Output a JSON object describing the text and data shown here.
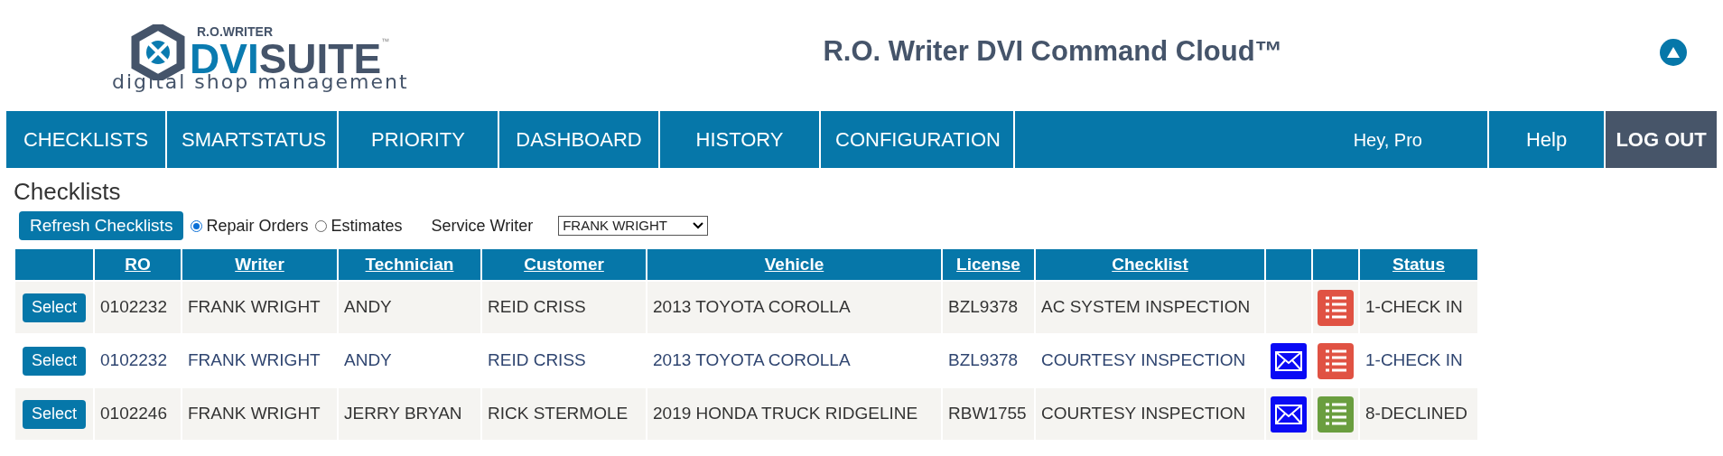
{
  "logo": {
    "brand_top": "R.O.WRITER",
    "brand_main_a": "DVI",
    "brand_main_b": "SUITE",
    "trademark": "™",
    "tagline": "digital shop management"
  },
  "title": "R.O. Writer DVI Command Cloud™",
  "nav": [
    {
      "label": "CHECKLISTS"
    },
    {
      "label": "SMARTSTATUS"
    },
    {
      "label": "PRIORITY"
    },
    {
      "label": "DASHBOARD"
    },
    {
      "label": "HISTORY"
    },
    {
      "label": "CONFIGURATION"
    }
  ],
  "greeting": "Hey, Pro",
  "help": "Help",
  "logout": "LOG OUT",
  "heading": "Checklists",
  "refresh_button": "Refresh Checklists",
  "radios": [
    {
      "label": "Repair Orders",
      "selected": true
    },
    {
      "label": "Estimates",
      "selected": false
    }
  ],
  "service_writer": {
    "label": "Service Writer",
    "value": "FRANK WRIGHT"
  },
  "table": {
    "columns": [
      "",
      "RO",
      "Writer",
      "Technician",
      "Customer",
      "Vehicle",
      "License",
      "Checklist",
      "",
      "",
      "Status"
    ],
    "rows": [
      {
        "button": "Select",
        "ro": "0102232",
        "writer": "FRANK WRIGHT",
        "technician": "ANDY",
        "customer": "REID CRISS",
        "vehicle": "2013 TOYOTA COROLLA",
        "license": "BZL9378",
        "checklist": "AC SYSTEM INSPECTION",
        "email": false,
        "color": "#e05243",
        "status": "1-CHECK IN"
      },
      {
        "button": "Select",
        "ro": "0102232",
        "writer": "FRANK WRIGHT",
        "technician": "ANDY",
        "customer": "REID CRISS",
        "vehicle": "2013 TOYOTA COROLLA",
        "license": "BZL9378",
        "checklist": "COURTESY INSPECTION",
        "email": true,
        "color": "#e05243",
        "status": "1-CHECK IN"
      },
      {
        "button": "Select",
        "ro": "0102246",
        "writer": "FRANK WRIGHT",
        "technician": "JERRY BRYAN",
        "customer": "RICK STERMOLE",
        "vehicle": "2019 HONDA TRUCK RIDGELINE",
        "license": "RBW1755",
        "checklist": "COURTESY INSPECTION",
        "email": true,
        "color": "#6a9e3f",
        "status": "8-DECLINED"
      }
    ]
  }
}
